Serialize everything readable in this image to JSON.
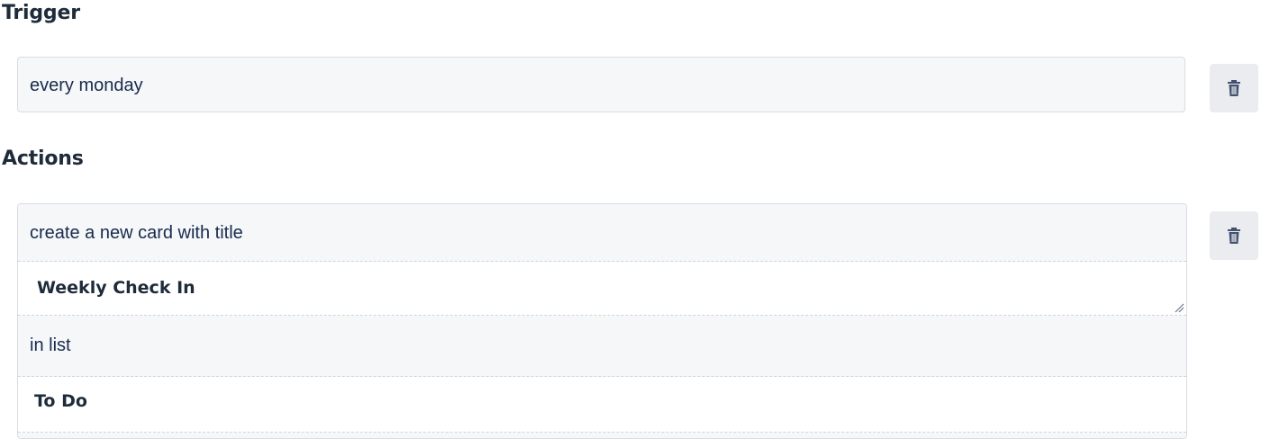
{
  "trigger": {
    "heading": "Trigger",
    "text": "every monday"
  },
  "actions": {
    "heading": "Actions",
    "action_label": "create a new card with title",
    "card_title": "Weekly Check In",
    "list_label": "in list",
    "list_name": "To Do"
  },
  "icons": {
    "delete": "trash-icon"
  },
  "colors": {
    "text": "#172b4d",
    "field_bg": "#f6f7f9",
    "button_bg": "#ebecf0",
    "border": "#d9dde2"
  }
}
